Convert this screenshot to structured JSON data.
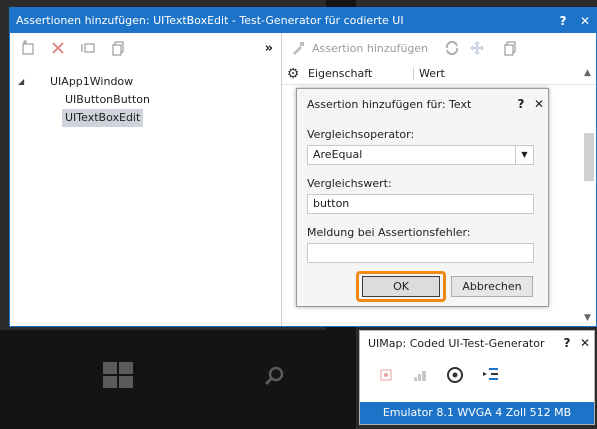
{
  "main_window": {
    "title": "Assertionen hinzufügen: UITextBoxEdit - Test-Generator für codierte UI",
    "help_label": "?",
    "close_label": "✕",
    "collapse_label": "»",
    "add_assertion_label": "Assertion hinzufügen"
  },
  "tree": {
    "root": "UIApp1Window",
    "children": [
      "UIButtonButton",
      "UITextBoxEdit"
    ],
    "selected": "UITextBoxEdit"
  },
  "properties": {
    "col_property": "Eigenschaft",
    "col_value": "Wert"
  },
  "dialog": {
    "title": "Assertion hinzufügen für: Text",
    "help_label": "?",
    "close_label": "✕",
    "comparator_label": "Vergleichsoperator:",
    "comparator_value": "AreEqual",
    "compare_value_label": "Vergleichswert:",
    "compare_value": "button",
    "message_label": "Meldung bei Assertionsfehler:",
    "message_value": "",
    "ok_label": "OK",
    "cancel_label": "Abbrechen"
  },
  "uimap": {
    "title": "UIMap: Coded UI-Test-Generator",
    "help_label": "?",
    "close_label": "✕",
    "status": "Emulator 8.1 WVGA 4 Zoll 512 MB"
  },
  "colors": {
    "accent": "#1c73c7",
    "focus_highlight": "#f08a13",
    "selection": "#cfd3dc"
  }
}
